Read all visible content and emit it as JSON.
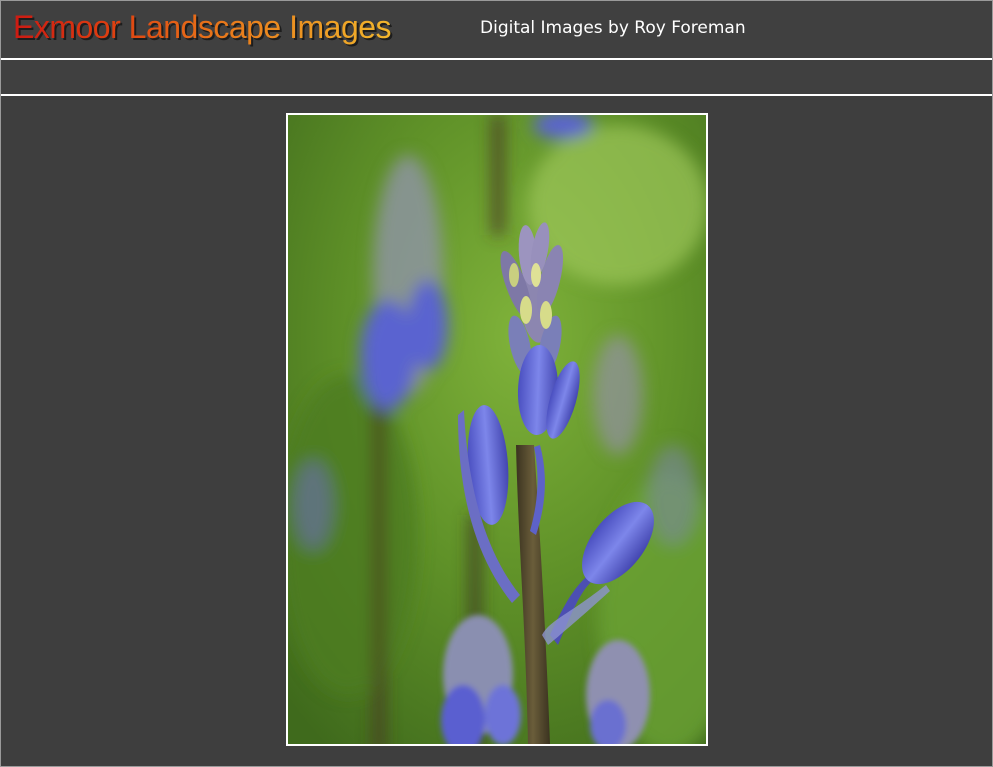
{
  "header": {
    "site_title": "Exmoor Landscape Images",
    "subtitle": "Digital Images by Roy Foreman"
  },
  "photo": {
    "alt": "Bluebell flower spike with buds"
  }
}
